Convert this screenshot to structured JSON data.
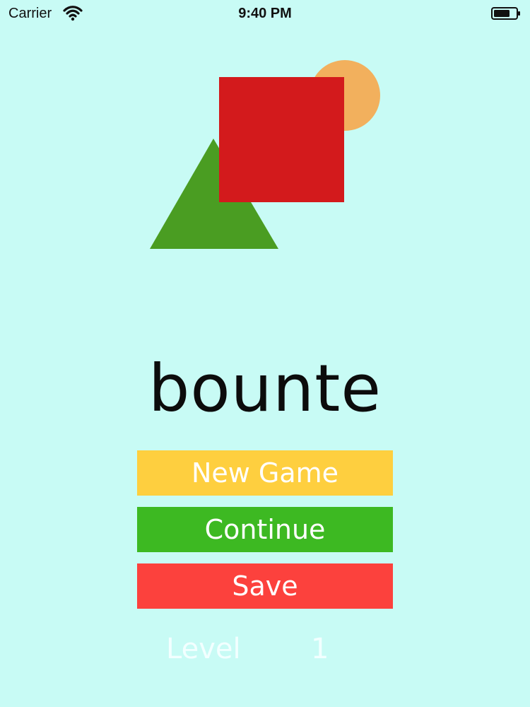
{
  "status_bar": {
    "carrier": "Carrier",
    "time": "9:40 PM",
    "icons": {
      "wifi": "wifi-icon",
      "battery": "battery-icon"
    }
  },
  "logo_art": {
    "shapes": [
      "circle-shape",
      "square-shape",
      "triangle-shape"
    ],
    "colors": {
      "circle": "#f2b05d",
      "square": "#d31a1c",
      "triangle": "#4a9d22"
    }
  },
  "game": {
    "title": "bounte"
  },
  "menu": {
    "new_game": "New Game",
    "continue": "Continue",
    "save": "Save",
    "colors": {
      "new_game": "#fecf3f",
      "continue": "#3db922",
      "save": "#fc413d"
    }
  },
  "level": {
    "label": "Level",
    "value": "1"
  },
  "theme": {
    "background": "#c8fbf5",
    "title_color": "#0c0c0c",
    "level_color": "#f2ffff"
  }
}
